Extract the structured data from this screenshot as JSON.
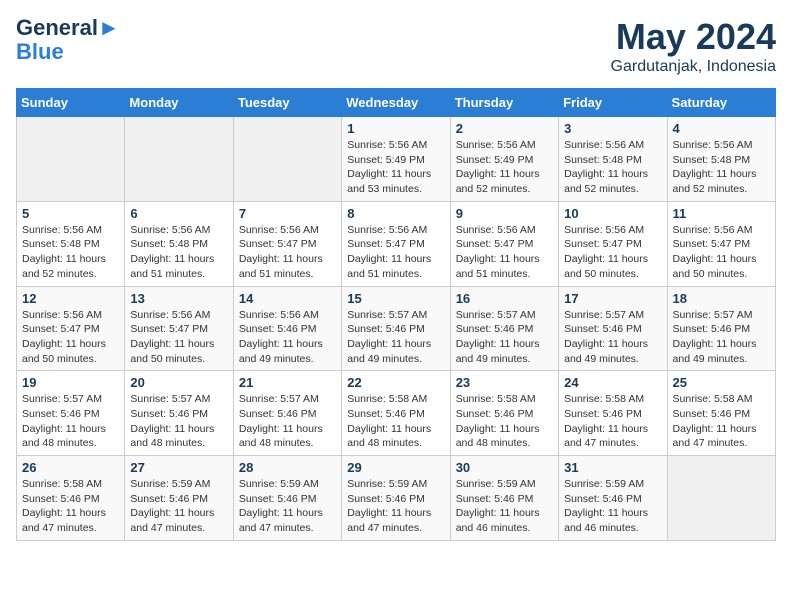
{
  "header": {
    "logo_line1": "General",
    "logo_line2": "Blue",
    "title": "May 2024",
    "subtitle": "Gardutanjak, Indonesia"
  },
  "calendar": {
    "weekdays": [
      "Sunday",
      "Monday",
      "Tuesday",
      "Wednesday",
      "Thursday",
      "Friday",
      "Saturday"
    ],
    "weeks": [
      [
        {
          "day": "",
          "info": ""
        },
        {
          "day": "",
          "info": ""
        },
        {
          "day": "",
          "info": ""
        },
        {
          "day": "1",
          "info": "Sunrise: 5:56 AM\nSunset: 5:49 PM\nDaylight: 11 hours\nand 53 minutes."
        },
        {
          "day": "2",
          "info": "Sunrise: 5:56 AM\nSunset: 5:49 PM\nDaylight: 11 hours\nand 52 minutes."
        },
        {
          "day": "3",
          "info": "Sunrise: 5:56 AM\nSunset: 5:48 PM\nDaylight: 11 hours\nand 52 minutes."
        },
        {
          "day": "4",
          "info": "Sunrise: 5:56 AM\nSunset: 5:48 PM\nDaylight: 11 hours\nand 52 minutes."
        }
      ],
      [
        {
          "day": "5",
          "info": "Sunrise: 5:56 AM\nSunset: 5:48 PM\nDaylight: 11 hours\nand 52 minutes."
        },
        {
          "day": "6",
          "info": "Sunrise: 5:56 AM\nSunset: 5:48 PM\nDaylight: 11 hours\nand 51 minutes."
        },
        {
          "day": "7",
          "info": "Sunrise: 5:56 AM\nSunset: 5:47 PM\nDaylight: 11 hours\nand 51 minutes."
        },
        {
          "day": "8",
          "info": "Sunrise: 5:56 AM\nSunset: 5:47 PM\nDaylight: 11 hours\nand 51 minutes."
        },
        {
          "day": "9",
          "info": "Sunrise: 5:56 AM\nSunset: 5:47 PM\nDaylight: 11 hours\nand 51 minutes."
        },
        {
          "day": "10",
          "info": "Sunrise: 5:56 AM\nSunset: 5:47 PM\nDaylight: 11 hours\nand 50 minutes."
        },
        {
          "day": "11",
          "info": "Sunrise: 5:56 AM\nSunset: 5:47 PM\nDaylight: 11 hours\nand 50 minutes."
        }
      ],
      [
        {
          "day": "12",
          "info": "Sunrise: 5:56 AM\nSunset: 5:47 PM\nDaylight: 11 hours\nand 50 minutes."
        },
        {
          "day": "13",
          "info": "Sunrise: 5:56 AM\nSunset: 5:47 PM\nDaylight: 11 hours\nand 50 minutes."
        },
        {
          "day": "14",
          "info": "Sunrise: 5:56 AM\nSunset: 5:46 PM\nDaylight: 11 hours\nand 49 minutes."
        },
        {
          "day": "15",
          "info": "Sunrise: 5:57 AM\nSunset: 5:46 PM\nDaylight: 11 hours\nand 49 minutes."
        },
        {
          "day": "16",
          "info": "Sunrise: 5:57 AM\nSunset: 5:46 PM\nDaylight: 11 hours\nand 49 minutes."
        },
        {
          "day": "17",
          "info": "Sunrise: 5:57 AM\nSunset: 5:46 PM\nDaylight: 11 hours\nand 49 minutes."
        },
        {
          "day": "18",
          "info": "Sunrise: 5:57 AM\nSunset: 5:46 PM\nDaylight: 11 hours\nand 49 minutes."
        }
      ],
      [
        {
          "day": "19",
          "info": "Sunrise: 5:57 AM\nSunset: 5:46 PM\nDaylight: 11 hours\nand 48 minutes."
        },
        {
          "day": "20",
          "info": "Sunrise: 5:57 AM\nSunset: 5:46 PM\nDaylight: 11 hours\nand 48 minutes."
        },
        {
          "day": "21",
          "info": "Sunrise: 5:57 AM\nSunset: 5:46 PM\nDaylight: 11 hours\nand 48 minutes."
        },
        {
          "day": "22",
          "info": "Sunrise: 5:58 AM\nSunset: 5:46 PM\nDaylight: 11 hours\nand 48 minutes."
        },
        {
          "day": "23",
          "info": "Sunrise: 5:58 AM\nSunset: 5:46 PM\nDaylight: 11 hours\nand 48 minutes."
        },
        {
          "day": "24",
          "info": "Sunrise: 5:58 AM\nSunset: 5:46 PM\nDaylight: 11 hours\nand 47 minutes."
        },
        {
          "day": "25",
          "info": "Sunrise: 5:58 AM\nSunset: 5:46 PM\nDaylight: 11 hours\nand 47 minutes."
        }
      ],
      [
        {
          "day": "26",
          "info": "Sunrise: 5:58 AM\nSunset: 5:46 PM\nDaylight: 11 hours\nand 47 minutes."
        },
        {
          "day": "27",
          "info": "Sunrise: 5:59 AM\nSunset: 5:46 PM\nDaylight: 11 hours\nand 47 minutes."
        },
        {
          "day": "28",
          "info": "Sunrise: 5:59 AM\nSunset: 5:46 PM\nDaylight: 11 hours\nand 47 minutes."
        },
        {
          "day": "29",
          "info": "Sunrise: 5:59 AM\nSunset: 5:46 PM\nDaylight: 11 hours\nand 47 minutes."
        },
        {
          "day": "30",
          "info": "Sunrise: 5:59 AM\nSunset: 5:46 PM\nDaylight: 11 hours\nand 46 minutes."
        },
        {
          "day": "31",
          "info": "Sunrise: 5:59 AM\nSunset: 5:46 PM\nDaylight: 11 hours\nand 46 minutes."
        },
        {
          "day": "",
          "info": ""
        }
      ]
    ]
  }
}
